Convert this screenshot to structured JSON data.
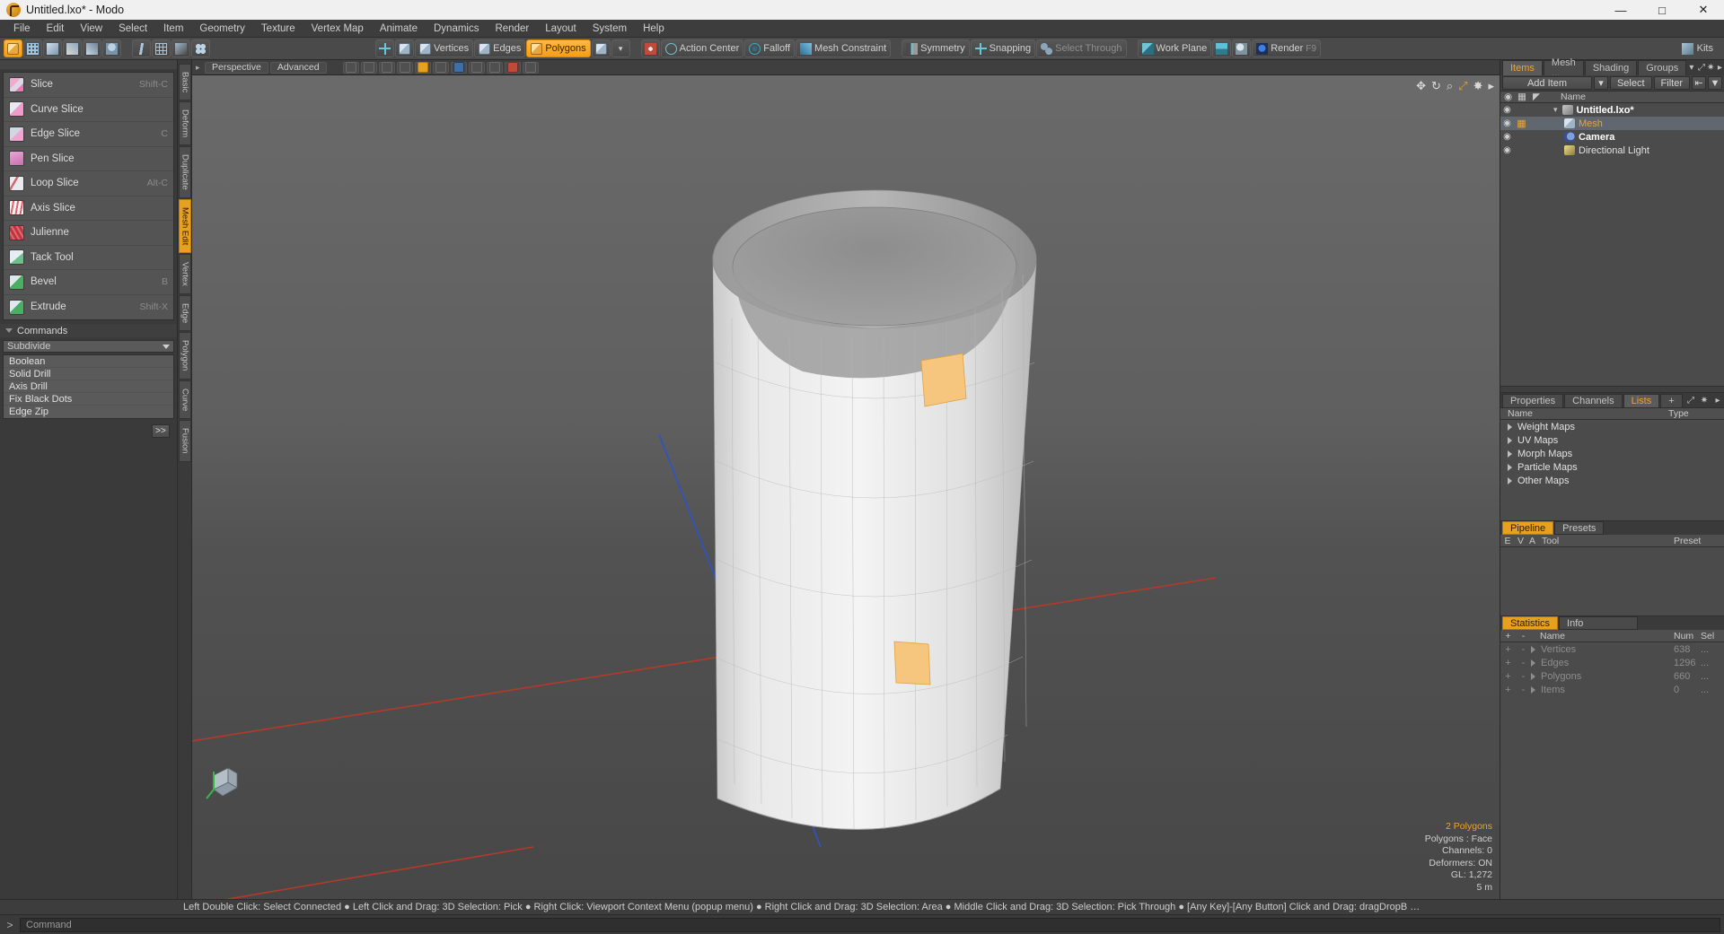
{
  "window": {
    "title": "Untitled.lxo* - Modo",
    "icon": "modo-logo-icon",
    "minimize": "—",
    "maximize": "□",
    "close": "✕"
  },
  "menubar": {
    "items": [
      "File",
      "Edit",
      "View",
      "Select",
      "Item",
      "Geometry",
      "Texture",
      "Vertex Map",
      "Animate",
      "Dynamics",
      "Render",
      "Layout",
      "System",
      "Help"
    ]
  },
  "toolbar": {
    "left_icons": [
      "item-mode-icon",
      "translate-icon",
      "element-move-icon",
      "paint-icon",
      "brush-icon",
      "clone-icon",
      "curve-icon",
      "grid-icon",
      "falloff-small-icon",
      "dots-icon"
    ],
    "selection_modes": [
      {
        "label": "",
        "icon": "center-pivot-icon",
        "active": false
      },
      {
        "label": "",
        "icon": "item-cube-icon",
        "active": false
      },
      {
        "label": "Vertices",
        "icon": "vertices-icon",
        "active": false
      },
      {
        "label": "Edges",
        "icon": "edges-icon",
        "active": false
      },
      {
        "label": "Polygons",
        "icon": "polygons-icon",
        "active": true
      },
      {
        "label": "",
        "icon": "materials-cube-icon",
        "active": false
      }
    ],
    "dropdown_caret": "▾",
    "modifiers": [
      {
        "label": "Action Center",
        "icon": "action-center-icon",
        "dim": false
      },
      {
        "label": "Falloff",
        "icon": "falloff-icon",
        "dim": false
      },
      {
        "label": "Mesh Constraint",
        "icon": "mesh-constraint-icon",
        "dim": false
      },
      {
        "label": "Symmetry",
        "icon": "symmetry-icon",
        "dim": false
      },
      {
        "label": "Snapping",
        "icon": "snapping-icon",
        "dim": false
      },
      {
        "label": "Select Through",
        "icon": "select-through-icon",
        "dim": true
      },
      {
        "label": "Work Plane",
        "icon": "work-plane-icon",
        "dim": false
      }
    ],
    "render_button": {
      "label": "Render",
      "shortcut": "F9",
      "icon": "render-icon"
    },
    "preview_icons": [
      "preview-icon",
      "shading-icon"
    ],
    "kits": {
      "label": "Kits",
      "icon": "kits-icon"
    }
  },
  "left_panel": {
    "tools": [
      {
        "label": "Slice",
        "shortcut": "Shift-C",
        "icon": "slice-icon"
      },
      {
        "label": "Curve Slice",
        "shortcut": "",
        "icon": "curve-slice-icon"
      },
      {
        "label": "Edge Slice",
        "shortcut": "C",
        "icon": "edge-slice-icon"
      },
      {
        "label": "Pen Slice",
        "shortcut": "",
        "icon": "pen-slice-icon"
      },
      {
        "label": "Loop Slice",
        "shortcut": "Alt-C",
        "icon": "loop-slice-icon"
      },
      {
        "label": "Axis Slice",
        "shortcut": "",
        "icon": "axis-slice-icon"
      },
      {
        "label": "Julienne",
        "shortcut": "",
        "icon": "julienne-icon"
      },
      {
        "label": "Tack Tool",
        "shortcut": "",
        "icon": "tack-tool-icon"
      },
      {
        "label": "Bevel",
        "shortcut": "B",
        "icon": "bevel-icon"
      },
      {
        "label": "Extrude",
        "shortcut": "Shift-X",
        "icon": "extrude-icon"
      }
    ],
    "commands_section": {
      "title": "Commands",
      "dropdown_value": "Subdivide",
      "items": [
        "Subdivide",
        "Boolean",
        "Solid Drill",
        "Axis Drill",
        "Fix Black Dots",
        "Edge Zip"
      ],
      "more_button": ">>"
    },
    "vertical_tabs": [
      {
        "label": "Basic",
        "active": false
      },
      {
        "label": "Deform",
        "active": false
      },
      {
        "label": "Duplicate",
        "active": false
      },
      {
        "label": "Mesh Edit",
        "active": true
      },
      {
        "label": "Vertex",
        "active": false
      },
      {
        "label": "Edge",
        "active": false
      },
      {
        "label": "Polygon",
        "active": false
      },
      {
        "label": "Curve",
        "active": false
      },
      {
        "label": "Fusion",
        "active": false
      }
    ]
  },
  "viewport": {
    "view_label": "Perspective",
    "shading_label": "Advanced",
    "overlay_icons": [
      "move-icon",
      "rotate-icon",
      "zoom-icon",
      "fit-icon",
      "settings-icon",
      "expand-icon"
    ],
    "header_icons": [
      "grid-icon",
      "wireframe-icon",
      "shaded-icon",
      "texture-icon",
      "light-icon",
      "gl-icon",
      "camera-icon",
      "lock-icon",
      "select-icon",
      "render-region-icon",
      "fog-icon"
    ],
    "stats": {
      "selection": "2 Polygons",
      "polygons": "Polygons : Face",
      "channels": "Channels: 0",
      "deformers": "Deformers: ON",
      "gl": "GL: 1,272",
      "scale": "5 m"
    }
  },
  "right_panel": {
    "tabs": [
      {
        "label": "Items",
        "active": true
      },
      {
        "label": "Mesh ...",
        "active": false
      },
      {
        "label": "Shading",
        "active": false
      },
      {
        "label": "Groups",
        "active": false
      }
    ],
    "tab_icons": [
      "chevron-down-icon",
      "expand-icon",
      "gear-icon",
      "chevron-right-icon"
    ],
    "toolbar": {
      "add_item": "Add Item",
      "add_item_caret": "▾",
      "select": "Select",
      "filter": "Filter",
      "list_icon": "list-icon",
      "funnel_icon": "funnel-icon"
    },
    "items_header": {
      "eye": "eye-icon",
      "col2": "render-icon",
      "col3": "material-icon",
      "name": "Name"
    },
    "items": [
      {
        "name": "Untitled.lxo*",
        "indent": 14,
        "bold": true,
        "selected": false,
        "icon": "scene-icon",
        "expander": "▾"
      },
      {
        "name": "Mesh",
        "indent": 28,
        "bold": false,
        "selected": true,
        "icon": "mesh-icon",
        "expander": "",
        "orange": true
      },
      {
        "name": "Camera",
        "indent": 28,
        "bold": true,
        "selected": false,
        "icon": "camera-icon",
        "expander": ""
      },
      {
        "name": "Directional Light",
        "indent": 28,
        "bold": false,
        "selected": false,
        "icon": "light-icon",
        "expander": ""
      }
    ],
    "lists_tabs": [
      {
        "label": "Properties",
        "active": false
      },
      {
        "label": "Channels",
        "active": false
      },
      {
        "label": "Lists",
        "active": true
      },
      {
        "label": "+",
        "active": false
      }
    ],
    "lists_header": {
      "name": "Name",
      "type": "Type"
    },
    "lists_rows": [
      "Weight Maps",
      "UV Maps",
      "Morph Maps",
      "Particle Maps",
      "Other Maps"
    ],
    "pipeline": {
      "tab_active": "Pipeline",
      "tab_inactive": "Presets",
      "columns": [
        "E",
        "V",
        "A",
        "Tool",
        "Preset"
      ]
    },
    "statistics": {
      "tab_active": "Statistics",
      "tab_inactive": "Info",
      "plus": "+",
      "minus": "-",
      "columns": [
        "Name",
        "Num",
        "Sel"
      ],
      "rows": [
        {
          "name": "Vertices",
          "num": "638",
          "sel": "..."
        },
        {
          "name": "Edges",
          "num": "1296",
          "sel": "..."
        },
        {
          "name": "Polygons",
          "num": "660",
          "sel": "..."
        },
        {
          "name": "Items",
          "num": "0",
          "sel": "..."
        }
      ]
    }
  },
  "statusbar": {
    "text": "Left Double Click: Select Connected ● Left Click and Drag: 3D Selection: Pick ● Right Click: Viewport Context Menu (popup menu) ● Right Click and Drag: 3D Selection: Area ● Middle Click and Drag: 3D Selection: Pick Through ● [Any Key]-[Any Button] Click and Drag: dragDropB …"
  },
  "commandline": {
    "arrow": ">",
    "placeholder": "Command"
  },
  "colors": {
    "accent": "#f0a32a",
    "selection_fill": "#f5c97f",
    "panel_bg": "#3a3a3a",
    "axis_red": "#c0392b",
    "axis_blue": "#2a4fb8"
  }
}
